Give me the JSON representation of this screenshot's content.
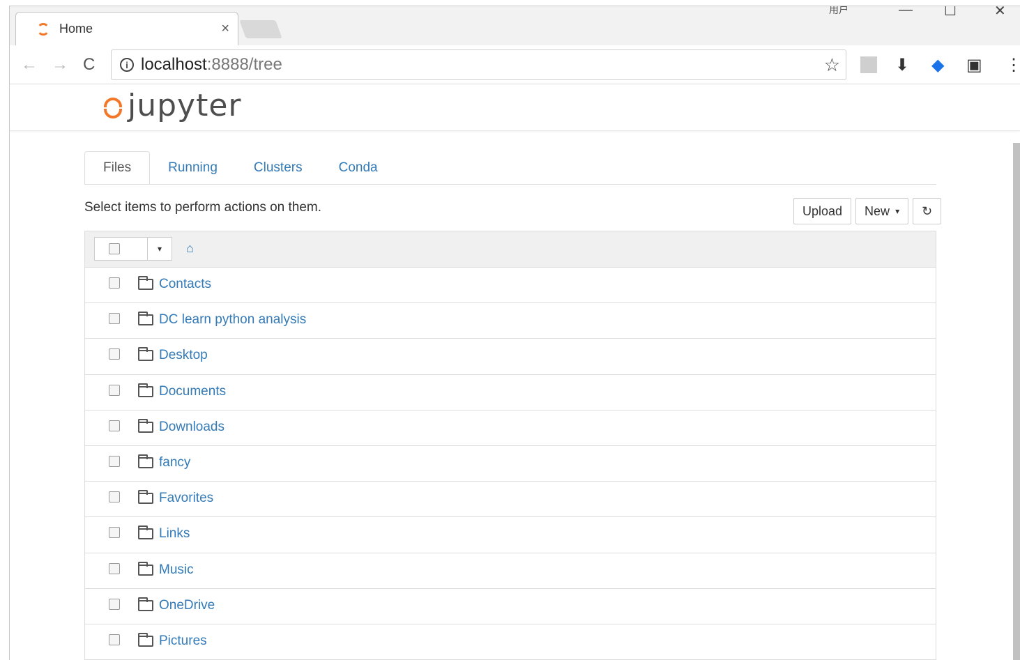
{
  "browser": {
    "tab_title": "Home",
    "tab_close": "×",
    "url_host": "localhost",
    "url_path": ":8888/tree",
    "window_user_label": "用户",
    "min_glyph": "—",
    "max_glyph": "☐",
    "close_glyph": "✕",
    "back_glyph": "←",
    "forward_glyph": "→",
    "reload_glyph": "C",
    "info_glyph": "i",
    "star_glyph": "☆",
    "download_glyph": "⬇",
    "ext_blue_glyph": "◆",
    "ext_dark_glyph": "▣",
    "menu_glyph": "⋮"
  },
  "jupyter": {
    "logo_text": "jupyter",
    "tabs": [
      "Files",
      "Running",
      "Clusters",
      "Conda"
    ],
    "hint": "Select items to perform actions on them.",
    "upload_label": "Upload",
    "new_label": "New",
    "caret": "▾",
    "refresh_glyph": "↻",
    "home_glyph": "⌂",
    "dropdown_caret": "▾"
  },
  "files": [
    {
      "name": "Contacts"
    },
    {
      "name": "DC learn python analysis"
    },
    {
      "name": "Desktop"
    },
    {
      "name": "Documents"
    },
    {
      "name": "Downloads"
    },
    {
      "name": "fancy"
    },
    {
      "name": "Favorites"
    },
    {
      "name": "Links"
    },
    {
      "name": "Music"
    },
    {
      "name": "OneDrive"
    },
    {
      "name": "Pictures"
    }
  ]
}
